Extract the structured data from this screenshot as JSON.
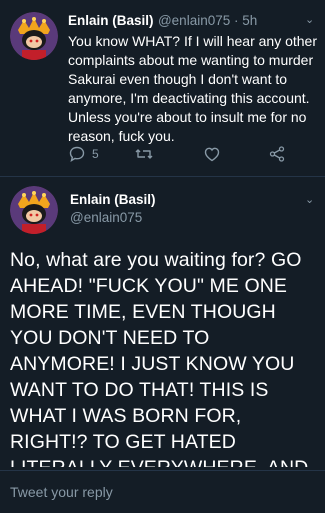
{
  "tweet1": {
    "name": "Enlain (Basil)",
    "handle_time": "@enlain075 · 5h",
    "text": "You know WHAT? If I will hear any other complaints about me wanting to murder Sakurai even though I don't want to anymore, I'm deactivating this account. Unless you're about to insult me for no reason, fuck you.",
    "reply_count": "5",
    "icons": [
      "reply-icon",
      "retweet-icon",
      "like-icon",
      "share-icon"
    ]
  },
  "tweet2": {
    "name": "Enlain (Basil)",
    "handle": "@enlain075",
    "text": "No, what are you waiting for? GO AHEAD! \"FUCK YOU\" ME ONE MORE TIME, EVEN THOUGH YOU DON'T NEED TO ANYMORE! I JUST KNOW YOU WANT TO DO THAT! THIS IS WHAT I WAS BORN FOR, RIGHT!? TO GET HATED LITERALLY EVERYWHERE, AND NOT JUST REAL LIFE!? TO GET"
  },
  "reply_bar": {
    "placeholder": "Tweet your reply"
  },
  "colors": {
    "background": "#141d26",
    "secondary_text": "#8899a6",
    "divider": "#243447"
  }
}
